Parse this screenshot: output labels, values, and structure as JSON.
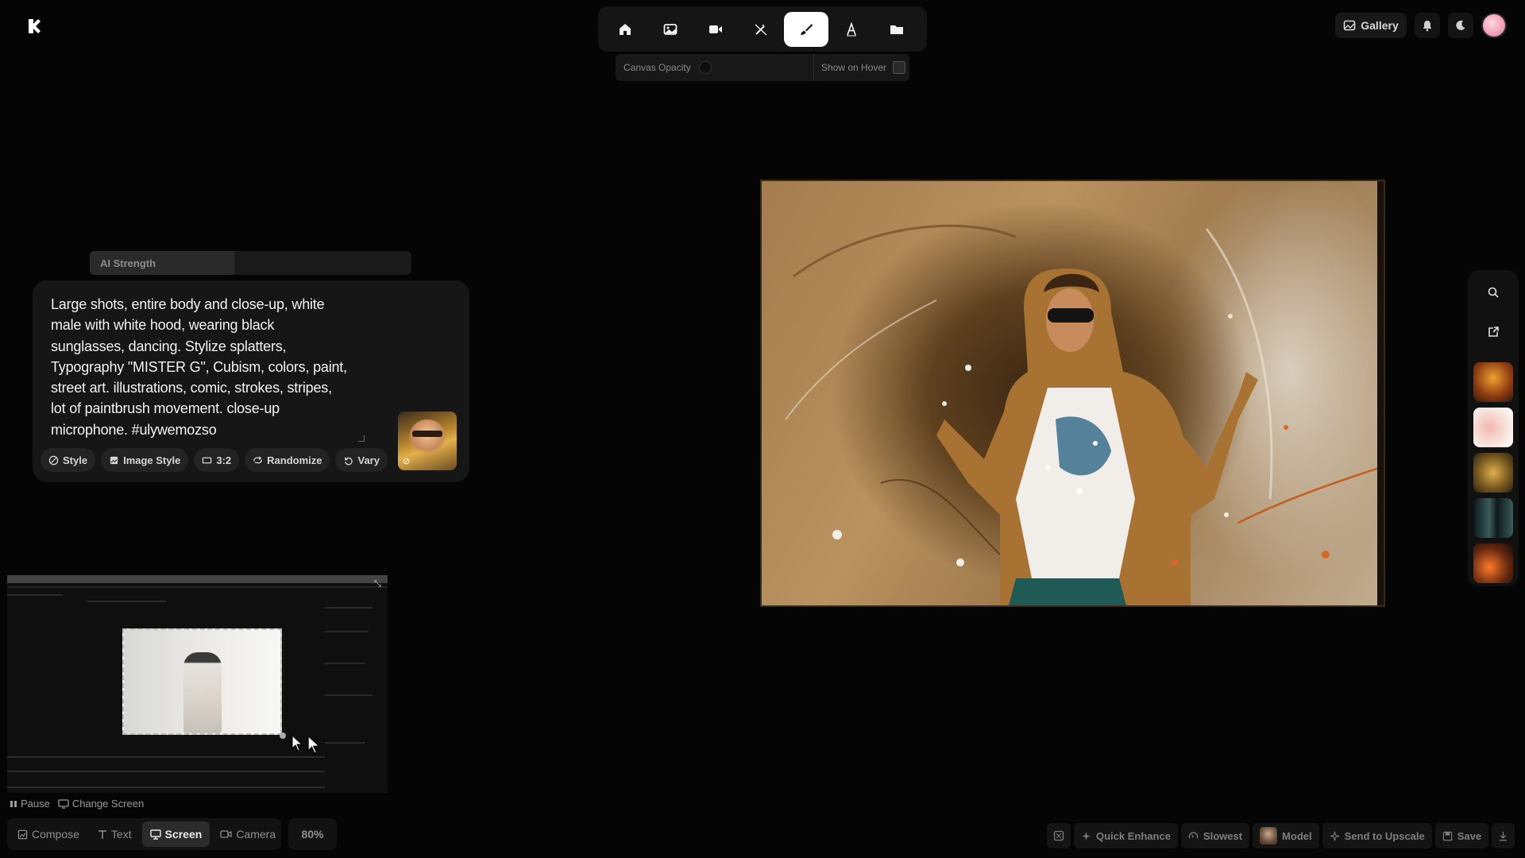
{
  "toolbar": {
    "tools": [
      "home",
      "image",
      "video",
      "magic-wand",
      "brush",
      "text",
      "folder"
    ],
    "active_tool": "brush"
  },
  "canvas_controls": {
    "opacity_label": "Canvas Opacity",
    "hover_label": "Show on Hover"
  },
  "header": {
    "gallery_label": "Gallery"
  },
  "ai_strength": {
    "label": "AI Strength",
    "value_fraction": 0.45
  },
  "prompt": {
    "lines": [
      "Large shots, entire body and close-up, white",
      "male with white hood, wearing black",
      "sunglasses, dancing. Stylize splatters,",
      "Typography \"MISTER G\", Cubism, colors, paint,",
      "street art. illustrations, comic, strokes, stripes,",
      "lot of paintbrush movement. close-up",
      "microphone. #ulywemozso"
    ],
    "chips": {
      "style": "Style",
      "image_style": "Image Style",
      "ratio": "3:2",
      "randomize": "Randomize",
      "vary": "Vary"
    }
  },
  "screen_capture": {
    "pause_label": "Pause",
    "change_label": "Change Screen"
  },
  "mode_bar": {
    "compose": "Compose",
    "text": "Text",
    "screen": "Screen",
    "camera": "Camera",
    "active": "Screen",
    "zoom": "80%"
  },
  "actions": {
    "quick_enhance": "Quick Enhance",
    "speed": "Slowest",
    "model": "Model",
    "send_upscale": "Send to Upscale",
    "save": "Save"
  },
  "colors": {
    "background": "#050505",
    "panel": "#161616",
    "active_tool_bg": "#ffffff"
  }
}
